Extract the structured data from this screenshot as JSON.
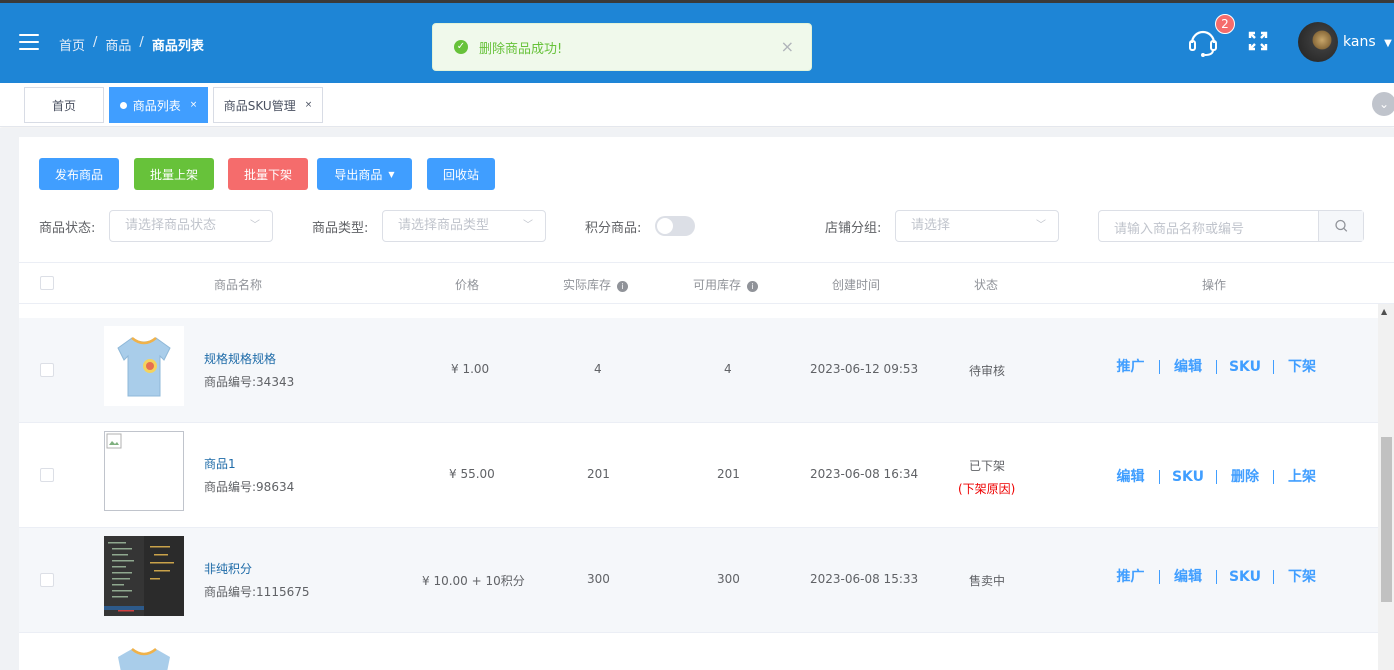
{
  "header": {
    "breadcrumb": [
      "首页",
      "商品",
      "商品列表"
    ],
    "breadcrumb_sep": "/",
    "notification_count": "2",
    "username": "kans"
  },
  "toast": {
    "message": "删除商品成功!",
    "close": "×"
  },
  "tabs": [
    {
      "label": "首页"
    },
    {
      "label": "商品列表",
      "close": "×"
    },
    {
      "label": "商品SKU管理",
      "close": "×"
    }
  ],
  "toolbar": {
    "publish": "发布商品",
    "bulk_on": "批量上架",
    "bulk_off": "批量下架",
    "export": "导出商品",
    "recycle": "回收站"
  },
  "filters": {
    "status_label": "商品状态:",
    "status_placeholder": "请选择商品状态",
    "type_label": "商品类型:",
    "type_placeholder": "请选择商品类型",
    "points_label": "积分商品:",
    "group_label": "店铺分组:",
    "group_placeholder": "请选择",
    "search_placeholder": "请输入商品名称或编号"
  },
  "table": {
    "headers": {
      "name": "商品名称",
      "price": "价格",
      "actual_stock": "实际库存",
      "available_stock": "可用库存",
      "created": "创建时间",
      "status": "状态",
      "actions": "操作"
    },
    "rows": [
      {
        "name": "规格规格规格",
        "code": "商品编号:34343",
        "price": "¥ 1.00",
        "actual": "4",
        "available": "4",
        "created": "2023-06-12 09:53",
        "status": "待审核",
        "reason": "",
        "ops": [
          "推广",
          "编辑",
          "SKU",
          "下架"
        ]
      },
      {
        "name": "商品1",
        "code": "商品编号:98634",
        "price": "¥ 55.00",
        "actual": "201",
        "available": "201",
        "created": "2023-06-08 16:34",
        "status": "已下架",
        "reason": "(下架原因)",
        "ops": [
          "编辑",
          "SKU",
          "删除",
          "上架"
        ]
      },
      {
        "name": "非纯积分",
        "code": "商品编号:1115675",
        "price": "¥ 10.00 + 10积分",
        "actual": "300",
        "available": "300",
        "created": "2023-06-08 15:33",
        "status": "售卖中",
        "reason": "",
        "ops": [
          "推广",
          "编辑",
          "SKU",
          "下架"
        ]
      },
      {
        "name": "",
        "code": "",
        "price": "",
        "actual": "",
        "available": "",
        "created": "",
        "status": "",
        "reason": "",
        "ops": []
      }
    ]
  },
  "colors": {
    "header_bg": "#1e85d6",
    "primary": "#409eff",
    "success": "#67c23a",
    "danger": "#f56c6c"
  }
}
